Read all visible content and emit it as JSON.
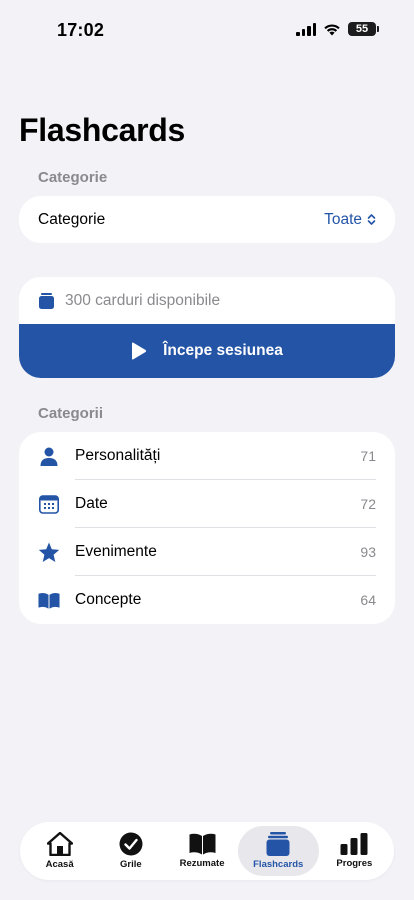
{
  "status": {
    "time": "17:02",
    "battery": "55"
  },
  "title": "Flashcards",
  "filter": {
    "section_label": "Categorie",
    "label": "Categorie",
    "value": "Toate"
  },
  "session": {
    "available": "300 carduri disponibile",
    "start_label": "Începe sesiunea"
  },
  "categories": {
    "section_label": "Categorii",
    "items": [
      {
        "name": "Personalități",
        "count": "71",
        "icon": "person-icon"
      },
      {
        "name": "Date",
        "count": "72",
        "icon": "calendar-icon"
      },
      {
        "name": "Evenimente",
        "count": "93",
        "icon": "star-icon"
      },
      {
        "name": "Concepte",
        "count": "64",
        "icon": "book-icon"
      }
    ]
  },
  "tabs": [
    {
      "label": "Acasă",
      "icon": "home-icon",
      "active": false
    },
    {
      "label": "Grile",
      "icon": "checkmark-circle-icon",
      "active": false
    },
    {
      "label": "Rezumate",
      "icon": "book-icon",
      "active": false
    },
    {
      "label": "Flashcards",
      "icon": "cards-stack-icon",
      "active": true
    },
    {
      "label": "Progres",
      "icon": "bar-chart-icon",
      "active": false
    }
  ],
  "colors": {
    "accent": "#2454a6",
    "background": "#f2f2f7",
    "secondary_text": "#8a8a8e"
  }
}
